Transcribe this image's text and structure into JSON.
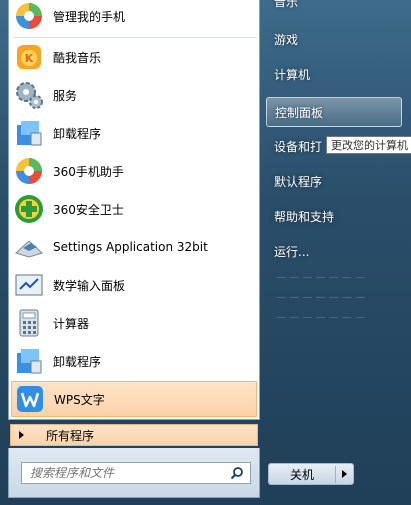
{
  "programs": [
    {
      "label": "管理我的手机",
      "icon": "360-phone-manager-icon"
    },
    {
      "label": "酷我音乐",
      "icon": "kuwo-music-icon"
    },
    {
      "label": "服务",
      "icon": "services-gear-icon"
    },
    {
      "label": "卸载程序",
      "icon": "uninstall-icon"
    },
    {
      "label": "360手机助手",
      "icon": "360-phone-assistant-icon"
    },
    {
      "label": "360安全卫士",
      "icon": "360-security-icon"
    },
    {
      "label": "Settings Application 32bit",
      "icon": "settings-app-icon"
    },
    {
      "label": "数学输入面板",
      "icon": "math-input-panel-icon"
    },
    {
      "label": "计算器",
      "icon": "calculator-icon"
    },
    {
      "label": "卸载程序",
      "icon": "uninstall-icon"
    },
    {
      "label": "WPS文字",
      "icon": "wps-writer-icon"
    }
  ],
  "all_programs": "所有程序",
  "search": {
    "placeholder": "搜索程序和文件"
  },
  "right_items": [
    {
      "label": "音乐"
    },
    {
      "label": "游戏"
    },
    {
      "label": "计算机"
    },
    {
      "label": "控制面板"
    },
    {
      "label": "设备和打"
    },
    {
      "label": "默认程序"
    },
    {
      "label": "帮助和支持"
    },
    {
      "label": "运行..."
    }
  ],
  "tooltip": "更改您的计算机",
  "shutdown": {
    "label": "关机"
  },
  "colors": {
    "highlight": "#fbd2a8",
    "accent": "#2a4e6a",
    "wps_blue": "#2f8ee8"
  }
}
